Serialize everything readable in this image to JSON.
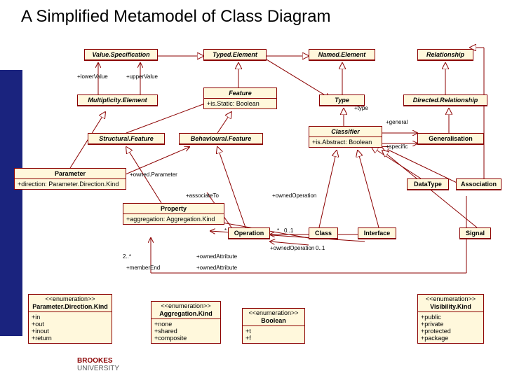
{
  "title": "A Simplified Metamodel of Class Diagram",
  "classes": {
    "valueSpecification": {
      "name": "Value.Specification"
    },
    "typedElement": {
      "name": "Typed.Element"
    },
    "namedElement": {
      "name": "Named.Element"
    },
    "relationship": {
      "name": "Relationship"
    },
    "multiplicityElement": {
      "name": "Multiplicity.Element"
    },
    "feature": {
      "name": "Feature",
      "attrs": [
        "+is.Static: Boolean"
      ]
    },
    "type": {
      "name": "Type"
    },
    "directedRelationship": {
      "name": "Directed.Relationship"
    },
    "structuralFeature": {
      "name": "Structural.Feature"
    },
    "behaviouralFeature": {
      "name": "Behavioural.Feature"
    },
    "classifier": {
      "name": "Classifier",
      "attrs": [
        "+is.Abstract: Boolean"
      ]
    },
    "generalisation": {
      "name": "Generalisation"
    },
    "parameter": {
      "name": "Parameter",
      "attrs": [
        "+direction: Parameter.Direction.Kind"
      ]
    },
    "dataType": {
      "name": "DataType"
    },
    "association": {
      "name": "Association"
    },
    "property": {
      "name": "Property",
      "attrs": [
        "+aggregation: Aggregation.Kind"
      ]
    },
    "operation": {
      "name": "Operation"
    },
    "classC": {
      "name": "Class"
    },
    "interface": {
      "name": "Interface"
    },
    "signal": {
      "name": "Signal"
    }
  },
  "enums": {
    "parameterDirectionKind": {
      "stereo": "<<enumeration>>",
      "name": "Parameter.Direction.Kind",
      "lits": [
        "+in",
        "+out",
        "+inout",
        "+return"
      ]
    },
    "aggregationKind": {
      "stereo": "<<enumeration>>",
      "name": "Aggregation.Kind",
      "lits": [
        "+none",
        "+shared",
        "+composite"
      ]
    },
    "boolean": {
      "stereo": "<<enumeration>>",
      "name": "Boolean",
      "lits": [
        "+t",
        "+f"
      ]
    },
    "visibilityKind": {
      "stereo": "<<enumeration>>",
      "name": "Visibility.Kind",
      "lits": [
        "+public",
        "+private",
        "+protected",
        "+package"
      ]
    }
  },
  "labels": {
    "lowerValue": "+lowerValue",
    "upperValue": "+upperValue",
    "type": "+type",
    "general": "+general",
    "specific": "+specific",
    "ownedParameter": "+owned.Parameter",
    "associateTo": "+associateTo",
    "ownedOperation": "+ownedOperation",
    "ownedOperation2": "+ownedOperation",
    "ownedAttribute": "+ownedAttribute",
    "ownedAttribute2": "+ownedAttribute",
    "memberEnd": "+memberEnd",
    "multStar": "*",
    "mult01": "0..1",
    "mult01b": "0..1",
    "mult2star": "2..*"
  },
  "logo": {
    "brand": "BROOKES",
    "sub": "UNIVERSITY"
  }
}
